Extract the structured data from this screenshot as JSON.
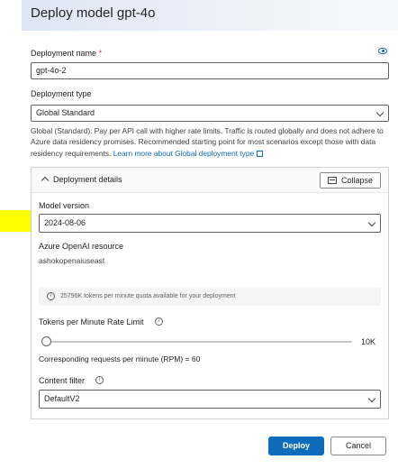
{
  "dialog": {
    "title": "Deploy model gpt-4o"
  },
  "deployment_name": {
    "label": "Deployment name",
    "required_mark": "*",
    "value": "gpt-4o-2"
  },
  "deployment_type": {
    "label": "Deployment type",
    "value": "Global Standard",
    "description": "Global (Standard): Pay per API call with higher rate limits. Traffic is routed globally and does not adhere to Azure data residency promises. Recommended starting point for most scenarios except those with data residency requirements.",
    "learn_more": "Learn more about Global deployment type"
  },
  "details": {
    "header": "Deployment details",
    "collapse_label": "Collapse",
    "model_version": {
      "label": "Model version",
      "value": "2024-08-06"
    },
    "resource": {
      "label": "Azure OpenAI resource",
      "value": "ashokopenaiuseast"
    },
    "quota_info": "25796K tokens per minute quota available for your deployment",
    "rate_limit": {
      "label": "Tokens per Minute Rate Limit",
      "value_label": "10K",
      "slider_fraction": 0.0,
      "rpm_text": "Corresponding requests per minute (RPM) = 60"
    },
    "content_filter": {
      "label": "Content filter",
      "value": "DefaultV2"
    }
  },
  "footer": {
    "deploy_label": "Deploy",
    "cancel_label": "Cancel"
  },
  "colors": {
    "accent": "#0f6cbd",
    "highlight": "#ffff00",
    "required": "#c4314b"
  },
  "icons": {
    "visibility": "eye-icon",
    "collapse": "collapse-icon",
    "info": "info-icon",
    "external": "external-link-icon"
  }
}
